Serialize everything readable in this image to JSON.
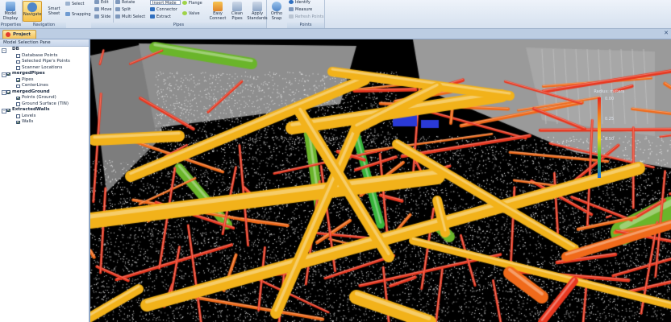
{
  "ribbon": {
    "groups": [
      {
        "label": "Properties"
      },
      {
        "label": "Navigation"
      },
      {
        "label": "Pipes"
      },
      {
        "label": "Points"
      }
    ],
    "buttons": {
      "model_display": "Model Display",
      "navigate": "Navigate",
      "select": "Select",
      "smart_sheet": "Smart Sheet",
      "snapping": "Snapping",
      "edit": "Edit",
      "move": "Move",
      "slide": "Slide",
      "rotate": "Rotate",
      "split": "Split",
      "multi_select": "Multi Select",
      "insert_mode": "Insert Mode",
      "connector": "Connector",
      "extract": "Extract",
      "flange": "Flange",
      "valve": "Valve",
      "easy_connect": "Easy Connect",
      "clean_pipes": "Clean Pipes",
      "apply_standards": "Apply Standards",
      "ortho_snap": "Ortho Snap",
      "identify": "Identify",
      "measure": "Measure",
      "refresh_points": "Refresh Points"
    }
  },
  "tabs": {
    "project": "Project",
    "close": "✕"
  },
  "pane": {
    "title": "Model Selection Pane",
    "tree": [
      {
        "label": "DB",
        "level": 0,
        "group": true
      },
      {
        "label": "Database Points",
        "level": 1,
        "checked": false
      },
      {
        "label": "Selected Pipe's Points",
        "level": 1,
        "checked": false
      },
      {
        "label": "Scanner Locations",
        "level": 1,
        "checked": false
      },
      {
        "label": "mergedPipes",
        "level": 0,
        "group": true,
        "checked": true
      },
      {
        "label": "Pipes",
        "level": 1,
        "checked": true
      },
      {
        "label": "CenterLines",
        "level": 1,
        "checked": false
      },
      {
        "label": "mergedGround",
        "level": 0,
        "group": true,
        "checked": true
      },
      {
        "label": "Points (Ground)",
        "level": 1,
        "checked": true
      },
      {
        "label": "Ground Surface (TIN)",
        "level": 1,
        "checked": false
      },
      {
        "label": "ExtractedWalls",
        "level": 0,
        "group": true,
        "checked": true
      },
      {
        "label": "Levels",
        "level": 1,
        "checked": false
      },
      {
        "label": "Walls",
        "level": 1,
        "checked": true
      }
    ]
  },
  "legend": {
    "title": "Radius: meters",
    "ticks": [
      "0.00",
      "0.25",
      "0.50"
    ],
    "gradient": [
      "#e8261f",
      "#f08a1d",
      "#f5d21c",
      "#3fbf3a",
      "#1f6de0"
    ]
  },
  "colors": {
    "pipe_large": "#f2b21a",
    "pipe_small": "#e8371f",
    "pipe_medium": "#f06a1a",
    "pipe_green": "#6ab52a",
    "wall": "#8c8c8c",
    "accent_blue": "#2a3ad6"
  }
}
